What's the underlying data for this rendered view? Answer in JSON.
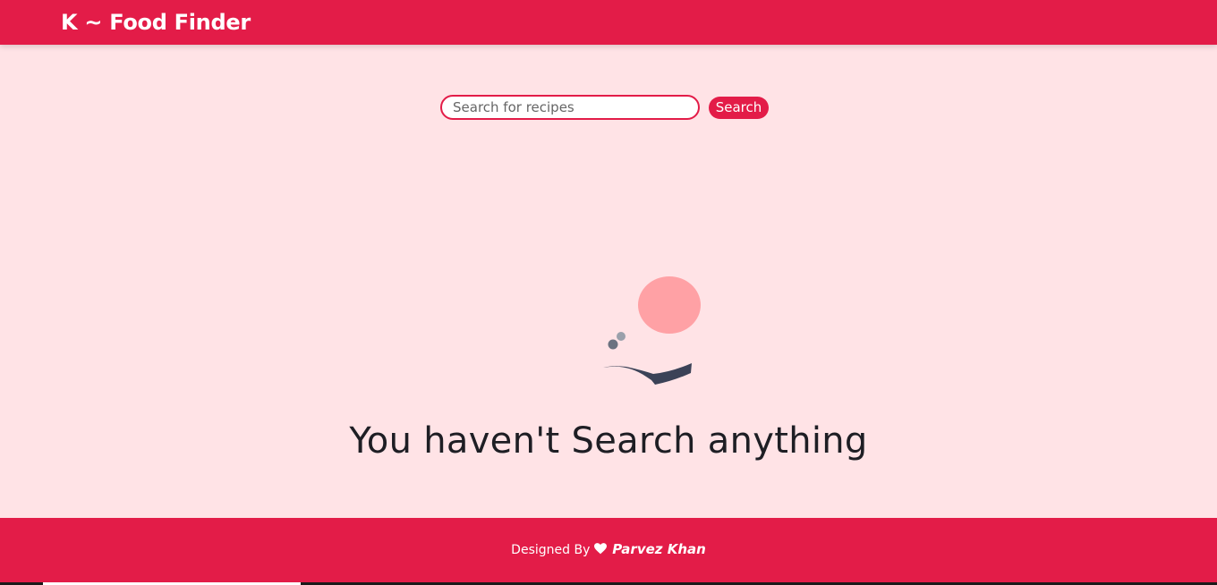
{
  "header": {
    "brand": "K ~ Food Finder",
    "color": "#e31c48"
  },
  "search": {
    "placeholder": "Search for recipes",
    "value": "",
    "button_label": "Search"
  },
  "empty_state": {
    "illustration": "frying-pan-illustration",
    "message": "You haven't Search anything"
  },
  "footer": {
    "designed_by_label": "Designed By",
    "icon": "heart-icon",
    "author": "Parvez Khan"
  },
  "colors": {
    "accent": "#e31c48",
    "background": "#ffe3e6",
    "text": "#1e1e24"
  }
}
